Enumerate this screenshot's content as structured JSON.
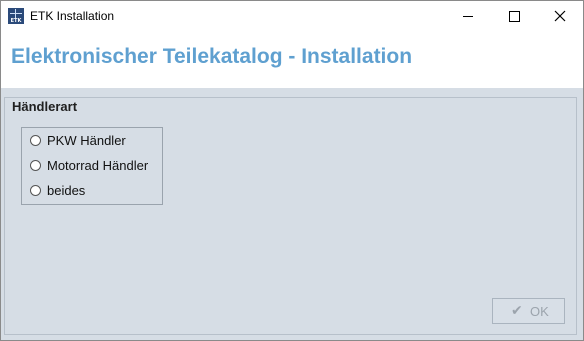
{
  "window": {
    "title": "ETK Installation",
    "icon_name": "etk-app-icon",
    "icon_text": "ETK"
  },
  "header": {
    "title": "Elektronischer Teilekatalog - Installation",
    "title_color": "#5fa0d0"
  },
  "group": {
    "label": "Händlerart",
    "options": [
      {
        "label": "PKW Händler",
        "selected": false
      },
      {
        "label": "Motorrad Händler",
        "selected": false
      },
      {
        "label": "beides",
        "selected": false
      }
    ]
  },
  "ok_button": {
    "label": "OK",
    "icon": "checkmark-icon",
    "enabled": false
  },
  "colors": {
    "panel_background": "#d6dde5",
    "disabled_text": "#9ca4ad"
  }
}
